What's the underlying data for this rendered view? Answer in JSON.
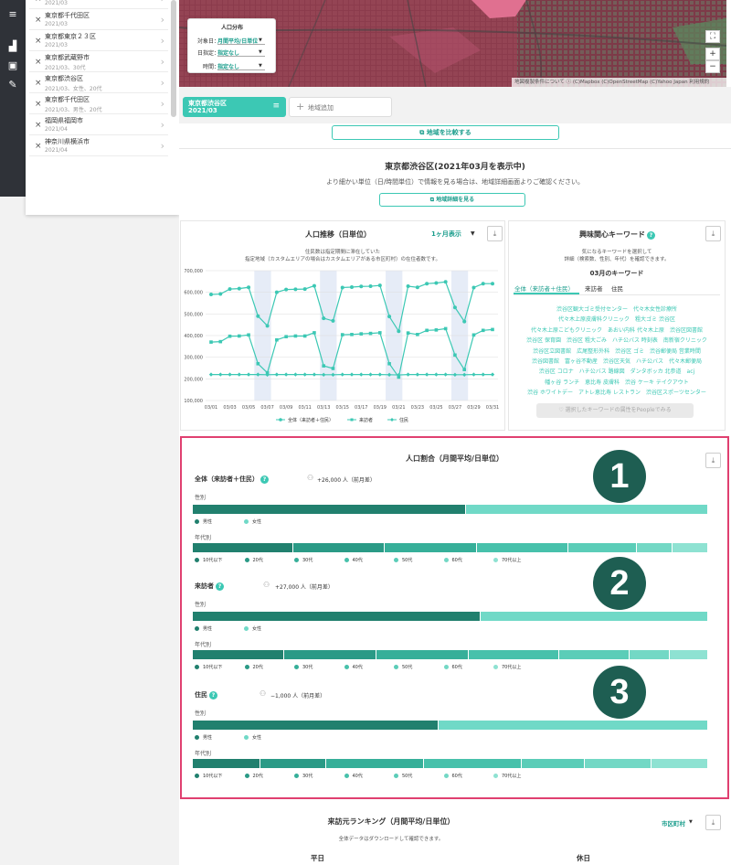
{
  "sidebar_icons": [
    "menu-icon",
    "chart-icon",
    "layers-icon",
    "edit-icon"
  ],
  "region_list": [
    {
      "name": "",
      "date": "2021/03"
    },
    {
      "name": "東京都千代田区",
      "date": "2021/03"
    },
    {
      "name": "東京都東京２３区",
      "date": "2021/03"
    },
    {
      "name": "東京都武蔵野市",
      "date": "2021/03、30代"
    },
    {
      "name": "東京都渋谷区",
      "date": "2021/03、女性、20代"
    },
    {
      "name": "東京都千代田区",
      "date": "2021/03、男性、20代"
    },
    {
      "name": "福岡県福岡市",
      "date": "2021/04"
    },
    {
      "name": "神奈川県横浜市",
      "date": "2021/04"
    }
  ],
  "map_filter": {
    "title": "人口分布",
    "rows": [
      {
        "label": "対象日：",
        "value": "月間平均/日単位"
      },
      {
        "label": "日指定：",
        "value": "指定なし"
      },
      {
        "label": "時間：",
        "value": "指定なし"
      }
    ]
  },
  "map_attribution": "地図複製条件について ⓘ   (C)Mapbox (C)OpenStreetMap (C)Yahoo Japan 利用規約",
  "zoom": {
    "plus": "+",
    "minus": "−",
    "fullscreen": "⛶"
  },
  "active_tab": {
    "name": "東京都渋谷区",
    "date": "2021/03"
  },
  "add_region_label": "地域追加",
  "compare_label": "地域を比較する",
  "header": {
    "title": "東京都渋谷区(2021年03月を表示中)",
    "note": "より細かい単位（日/時間単位）で情報を見る場合は、地域詳細画面よりご確認ください。",
    "detail_button": "地域詳細を見る"
  },
  "trend": {
    "title": "人口推移（日単位）",
    "period": "1ヶ月表示",
    "note1": "住民数は指定期間に滞在していた",
    "note2": "指定地域（カスタムエリアの場合はカスタムエリアがある市区町村）の在住者数です。"
  },
  "chart_data": {
    "type": "line",
    "title": "人口推移（日単位）",
    "ylim": [
      100000,
      700000
    ],
    "y_ticks": [
      "700,000",
      "600,000",
      "500,000",
      "400,000",
      "300,000",
      "200,000",
      "100,000"
    ],
    "x_labels": [
      "03/01",
      "03/03",
      "03/05",
      "03/07",
      "03/09",
      "03/11",
      "03/13",
      "03/15",
      "03/17",
      "03/19",
      "03/21",
      "03/23",
      "03/25",
      "03/27",
      "03/29",
      "03/31"
    ],
    "x": [
      1,
      2,
      3,
      4,
      5,
      6,
      7,
      8,
      9,
      10,
      11,
      12,
      13,
      14,
      15,
      16,
      17,
      18,
      19,
      20,
      21,
      22,
      23,
      24,
      25,
      26,
      27,
      28,
      29,
      30,
      31
    ],
    "series": [
      {
        "name": "全体（来訪者＋住民）",
        "color": "#3cc8b4",
        "values": [
          590000,
          592000,
          615000,
          617000,
          623000,
          490000,
          445000,
          600000,
          613000,
          614000,
          615000,
          630000,
          480000,
          468000,
          622000,
          624000,
          627000,
          628000,
          632000,
          488000,
          420000,
          628000,
          623000,
          640000,
          643000,
          648000,
          530000,
          465000,
          622000,
          640000,
          640000
        ]
      },
      {
        "name": "来訪者",
        "color": "#3cc8b4",
        "values": [
          370000,
          372000,
          397000,
          398000,
          403000,
          270000,
          228000,
          380000,
          395000,
          398000,
          398000,
          413000,
          260000,
          248000,
          404000,
          405000,
          408000,
          410000,
          413000,
          270000,
          208000,
          412000,
          405000,
          424000,
          426000,
          432000,
          310000,
          243000,
          403000,
          424000,
          428000
        ]
      },
      {
        "name": "住民",
        "color": "#3cc8b4",
        "values": [
          220000,
          220000,
          220000,
          220000,
          220000,
          220000,
          219000,
          220000,
          220000,
          220000,
          220000,
          220000,
          219000,
          219000,
          220000,
          220000,
          220000,
          220000,
          220000,
          219000,
          218000,
          220000,
          220000,
          220000,
          220000,
          220000,
          219000,
          219000,
          220000,
          220000,
          220000
        ]
      }
    ]
  },
  "keywords": {
    "title": "興味関心キーワード",
    "note1": "気になるキーワードを選択して",
    "note2": "詳細（検索数、性別、年代）を確認できます。",
    "month": "03月のキーワード",
    "tabs": [
      "全体（来訪者＋住民）",
      "来訪者",
      "住民"
    ],
    "lines": [
      "渋谷区観大ゴミ受付センター　代々木女性診療所",
      "代々木上原皮膚科クリニック　粗大ゴミ 渋谷区",
      "代々木上原こどもクリニック　あおい内科 代々木上原　渋谷区図書館",
      "渋谷区 保育園　渋谷区 粗大ごみ　ハチ公バス 時刻表　南新宿クリニック",
      "渋谷区立図書館　広尾整形外科　渋谷区 ゴミ　渋谷郵便局 営業時間",
      "渋谷図書館　富ヶ谷不動産　渋谷区天気　ハチ公バス　代々木郵便局",
      "渋谷区 コロナ　ハチ公バス 路線図　ダンタボッカ 北参道　acj",
      "幡ヶ谷 ランチ　恵比寿 皮膚科　渋谷 ケーキ テイクアウト",
      "渋谷 ホワイトデー　アトレ恵比寿 レストラン　渋谷区スポーツセンター"
    ],
    "button": "選択したキーワードの属性をPeopleでみる"
  },
  "pct": {
    "title": "人口割合（月間平均/日単位）",
    "gender_label": "性別",
    "age_label": "年代別",
    "gender_legend": [
      "男性",
      "女性"
    ],
    "age_legend": [
      "10代以下",
      "20代",
      "30代",
      "40代",
      "50代",
      "60代",
      "70代以上"
    ],
    "sections": [
      {
        "label": "全体（来訪者＋住民）",
        "count": "+26,000 人（前月差）",
        "badge": "1",
        "gender": [
          0.531,
          0.469
        ],
        "age": [
          0.195,
          0.178,
          0.178,
          0.178,
          0.132,
          0.07,
          0.069
        ]
      },
      {
        "label": "来訪者",
        "count": "+27,000 人（前月差）",
        "badge": "2",
        "gender": [
          0.559,
          0.441
        ],
        "age": [
          0.177,
          0.179,
          0.179,
          0.176,
          0.137,
          0.078,
          0.074
        ]
      },
      {
        "label": "住民",
        "count": "−1,000 人（前月差）",
        "badge": "3",
        "gender": [
          0.477,
          0.523
        ],
        "age": [
          0.131,
          0.128,
          0.19,
          0.19,
          0.121,
          0.13,
          0.11
        ]
      }
    ],
    "gender_colors": [
      "#21806e",
      "#70d9c7"
    ],
    "age_colors": [
      "#21806e",
      "#2a9a86",
      "#36af99",
      "#47c1ab",
      "#5bcdb8",
      "#73d8c5",
      "#8ee2d2"
    ]
  },
  "ranking": {
    "title": "来訪元ランキング（月間平均/日単位）",
    "note": "全体データはダウンロードして確認できます。",
    "select": "市区町村",
    "col1": "平日",
    "col2": "休日"
  }
}
